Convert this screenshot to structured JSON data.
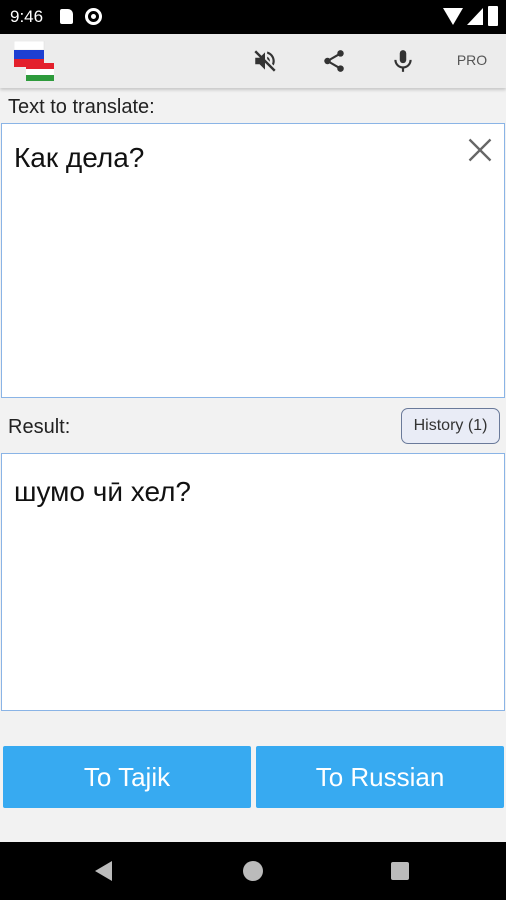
{
  "status_bar": {
    "time": "9:46"
  },
  "toolbar": {
    "icons": [
      "app-logo-icon",
      "volume-off-icon",
      "share-icon",
      "microphone-icon"
    ],
    "pro_label": "PRO"
  },
  "input": {
    "label": "Text to translate:",
    "value": "Как дела?"
  },
  "result": {
    "label": "Result:",
    "history_button": "History (1)",
    "value": "шумо чӣ хел?"
  },
  "actions": {
    "to_tajik": "To Tajik",
    "to_russian": "To Russian"
  },
  "colors": {
    "accent": "#37aaf1",
    "box_border": "#8ab4e6",
    "flag_white": "#ffffff",
    "flag_blue": "#1e3fd2",
    "flag_red": "#e3202c",
    "tj_green": "#2e9b3c"
  }
}
